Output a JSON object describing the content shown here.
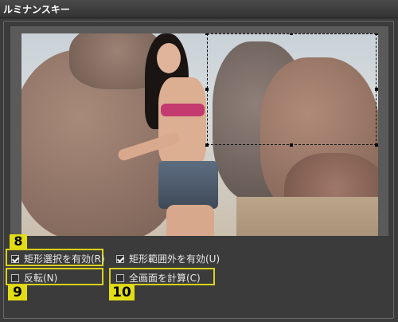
{
  "window": {
    "title": "ルミナンスキー"
  },
  "options": {
    "rect_select": {
      "label": "矩形選択を有効(R)",
      "checked": true
    },
    "outside_rect": {
      "label": "矩形範囲外を有効(U)",
      "checked": true
    },
    "invert": {
      "label": "反転(N)",
      "checked": false
    },
    "full_calc": {
      "label": "全画面を計算(C)",
      "checked": false
    }
  },
  "badges": {
    "b8": "8",
    "b9": "9",
    "b10": "10"
  },
  "colors": {
    "highlight": "#d9d21a",
    "badge": "#e2dd14"
  }
}
